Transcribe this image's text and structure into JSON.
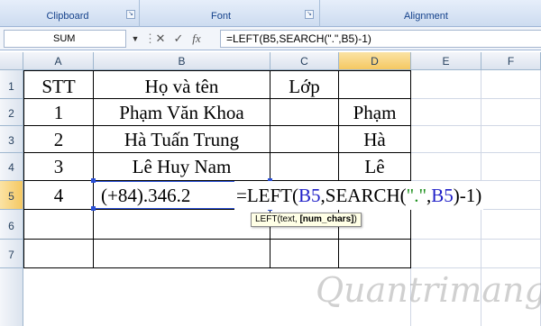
{
  "ribbon": {
    "groups": [
      "Clipboard",
      "Font",
      "Alignment"
    ]
  },
  "formula_bar": {
    "name_box": "SUM",
    "cancel_icon": "✕",
    "enter_icon": "✓",
    "fx_label": "fx",
    "formula": "=LEFT(B5,SEARCH(\".\",B5)-1)"
  },
  "columns": [
    "A",
    "B",
    "C",
    "D",
    "E",
    "F"
  ],
  "rows": [
    "1",
    "2",
    "3",
    "4",
    "5",
    "6",
    "7"
  ],
  "table": {
    "headers": [
      "STT",
      "Họ và tên",
      "Lớp"
    ],
    "rows": [
      {
        "stt": "1",
        "name": "Phạm Văn Khoa",
        "d": "Phạm"
      },
      {
        "stt": "2",
        "name": "Hà Tuấn Trung",
        "d": "Hà"
      },
      {
        "stt": "3",
        "name": "Lê Huy Nam",
        "d": "Lê"
      },
      {
        "stt": "4",
        "name": "(+84).346.2"
      }
    ]
  },
  "edit": {
    "p1": "=LEFT(",
    "p2": "B5",
    "p3": ",SEARCH(",
    "p4": "\".\"",
    "p5": ",",
    "p6": "B5",
    "p7": ")-1)"
  },
  "tooltip": {
    "fn": "LEFT(text, ",
    "arg": "[num_chars]",
    "close": ")"
  },
  "watermark": "Quantrimang",
  "colors": {
    "ref_blue": "#2020c8",
    "ref_green": "#1e8f1e",
    "header_selected": "#f5c862"
  }
}
